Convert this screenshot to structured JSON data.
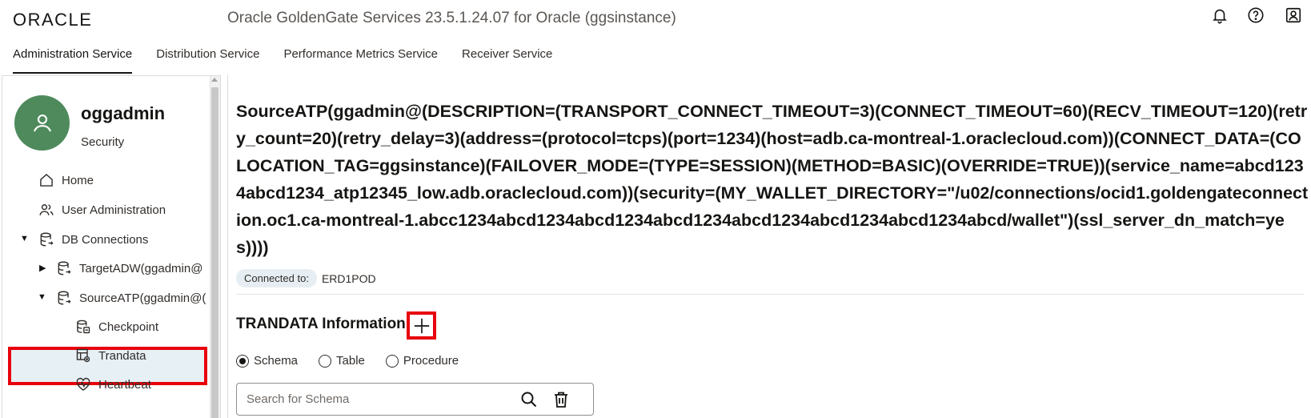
{
  "header": {
    "logo": "ORACLE",
    "app_title": "Oracle GoldenGate Services 23.5.1.24.07 for Oracle (ggsinstance)",
    "tabs": [
      {
        "label": "Administration Service",
        "active": true
      },
      {
        "label": "Distribution Service",
        "active": false
      },
      {
        "label": "Performance Metrics Service",
        "active": false
      },
      {
        "label": "Receiver Service",
        "active": false
      }
    ],
    "icons": [
      "bell-icon",
      "help-icon",
      "user-account-icon"
    ]
  },
  "sidebar": {
    "user_name": "oggadmin",
    "user_role": "Security",
    "items": [
      {
        "label": "Home",
        "icon": "home-icon"
      },
      {
        "label": "User Administration",
        "icon": "users-icon"
      },
      {
        "label": "DB Connections",
        "icon": "database-icon",
        "expanded": true
      },
      {
        "label": "TargetADW(ggadmin@",
        "icon": "database-icon",
        "expanded": false
      },
      {
        "label": "SourceATP(ggadmin@(",
        "icon": "database-icon",
        "expanded": true
      },
      {
        "label": "Checkpoint",
        "icon": "checkpoint-icon"
      },
      {
        "label": "Trandata",
        "icon": "trandata-icon",
        "selected": true
      },
      {
        "label": "Heartbeat",
        "icon": "heartbeat-icon"
      }
    ]
  },
  "main": {
    "connection_title": "SourceATP(ggadmin@(DESCRIPTION=(TRANSPORT_CONNECT_TIMEOUT=3)(CONNECT_TIMEOUT=60)(RECV_TIMEOUT=120)(retry_count=20)(retry_delay=3)(address=(protocol=tcps)(port=1234)(host=adb.ca-montreal-1.oraclecloud.com))(CONNECT_DATA=(COLOCATION_TAG=ggsinstance)(FAILOVER_MODE=(TYPE=SESSION)(METHOD=BASIC)(OVERRIDE=TRUE))(service_name=abcd1234abcd1234_atp12345_low.adb.oraclecloud.com))(security=(MY_WALLET_DIRECTORY=\"/u02/connections/ocid1.goldengateconnection.oc1.ca-montreal-1.abcc1234abcd1234abcd1234abcd1234abcd1234abcd1234abcd1234abcd/wallet\")(ssl_server_dn_match=yes))))",
    "connected_label": "Connected to:",
    "connected_value": "ERD1POD",
    "trandata_title": "TRANDATA Information",
    "radios": [
      {
        "label": "Schema",
        "checked": true
      },
      {
        "label": "Table",
        "checked": false
      },
      {
        "label": "Procedure",
        "checked": false
      }
    ],
    "search_placeholder": "Search for Schema"
  },
  "colors": {
    "avatar_bg": "#4e8a5c",
    "highlight_border": "#e8000b",
    "selected_bg": "#e6f0f5"
  }
}
